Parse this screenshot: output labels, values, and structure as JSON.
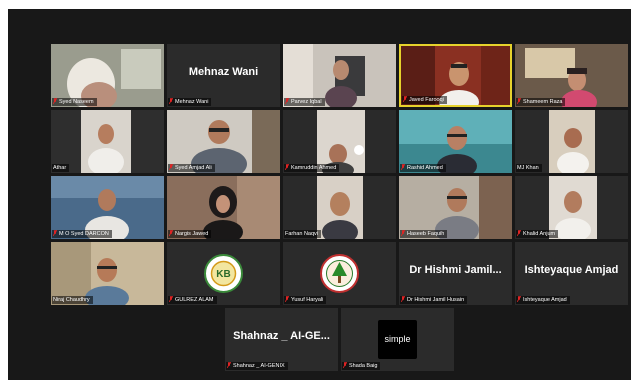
{
  "app": "Zoom Gallery View",
  "colors": {
    "muted_mic": "#e02424",
    "active_speaker": "#e6d22c",
    "tile_bg": "#2b2b2b",
    "gallery_bg": "#181818"
  },
  "participants": [
    {
      "label": "Syed Naseem",
      "muted": true
    },
    {
      "label": "Mehnaz Wani",
      "display_name": "Mehnaz Wani",
      "muted": true
    },
    {
      "label": "Parvez Iqbal",
      "muted": true
    },
    {
      "label": "Javed Farooqi",
      "muted": true,
      "active_speaker": true
    },
    {
      "label": "Shameem Raza",
      "muted": true
    },
    {
      "label": "Athar",
      "muted": false
    },
    {
      "label": "Syed Amjad Ali",
      "muted": true
    },
    {
      "label": "Kamruddin Ahmed",
      "muted": true
    },
    {
      "label": "Rashid Ahmed",
      "muted": true
    },
    {
      "label": "MJ Khan",
      "muted": false
    },
    {
      "label": "M O Syed DARCON",
      "muted": true
    },
    {
      "label": "Nargis Jawed",
      "muted": true
    },
    {
      "label": "Farhan Naqvi",
      "muted": false
    },
    {
      "label": "Haseeb Faquih",
      "muted": true
    },
    {
      "label": "Khalid Anjum",
      "muted": true
    },
    {
      "label": "Niraj Chaudhry",
      "muted": false
    },
    {
      "label": "GULREZ ALAM",
      "muted": true,
      "logo": "kb-circle-logo"
    },
    {
      "label": "Yusuf Haryali",
      "muted": true,
      "logo": "tree-emblem-logo"
    },
    {
      "label": "Dr Hishmi Jamil Husain",
      "display_name": "Dr Hishmi Jamil...",
      "muted": true
    },
    {
      "label": "Ishteyaque Amjad",
      "display_name": "Ishteyaque Amjad",
      "muted": true
    },
    {
      "label": "Shahnaz _ AI-GENIX",
      "display_name": "Shahnaz _ AI-GE...",
      "muted": true
    },
    {
      "label": "Shada Baig",
      "muted": true,
      "logo": "simple-logo",
      "logo_text": "simple"
    }
  ]
}
